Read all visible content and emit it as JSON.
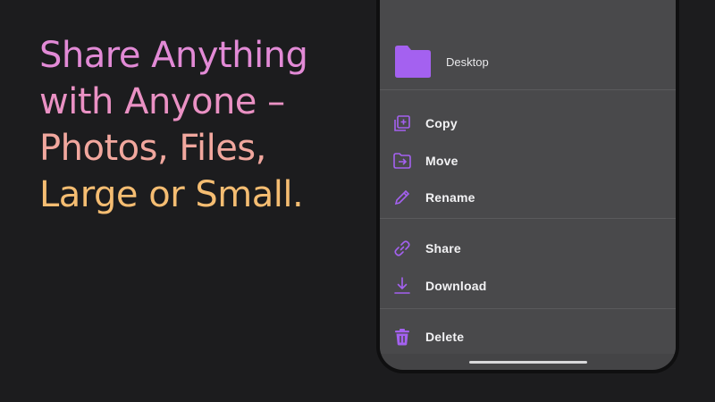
{
  "headline": {
    "line1": "Share Anything",
    "line2": "with Anyone –",
    "line3": "Photos, Files,",
    "line4": "Large or Small."
  },
  "folder": {
    "name": "Desktop",
    "icon": "folder-icon"
  },
  "menu": {
    "items": [
      {
        "label": "Copy",
        "icon": "copy-icon"
      },
      {
        "label": "Move",
        "icon": "move-icon"
      },
      {
        "label": "Rename",
        "icon": "pencil-icon"
      },
      {
        "label": "Share",
        "icon": "link-icon"
      },
      {
        "label": "Download",
        "icon": "download-icon"
      },
      {
        "label": "Delete",
        "icon": "trash-icon"
      }
    ]
  },
  "colors": {
    "background": "#1c1c1e",
    "sheet": "#49494b",
    "accent": "#a461f0",
    "headline_gradient": [
      "#e28ad6",
      "#ea91c4",
      "#f1a79e",
      "#f5bd72"
    ]
  }
}
